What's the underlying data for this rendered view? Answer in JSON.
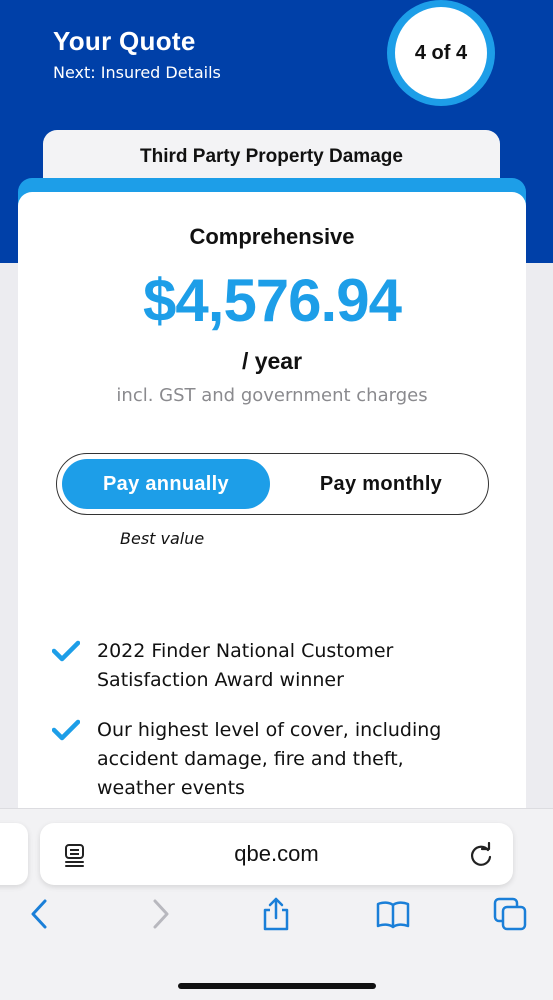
{
  "header": {
    "title": "Your Quote",
    "subtitle": "Next: Insured Details",
    "step": "4 of 4"
  },
  "tabs": {
    "other_plan": "Third Party Property Damage",
    "active_plan": "Comprehensive"
  },
  "quote": {
    "price": "$4,576.94",
    "period": "/ year",
    "note": "incl. GST and government charges"
  },
  "payment_toggle": {
    "annual": "Pay annually",
    "monthly": "Pay monthly",
    "selected": "annual",
    "annual_note": "Best value"
  },
  "features": [
    {
      "text": "2022 Finder National Customer Satisfaction Award winner"
    },
    {
      "text": "Our highest level of cover, including accident damage, fire and theft, weather events"
    }
  ],
  "browser": {
    "domain": "qbe.com"
  },
  "colors": {
    "brand_navy": "#0040a8",
    "accent_blue": "#1d9ee8"
  },
  "icons": [
    "reader-icon",
    "reload-icon",
    "back-icon",
    "forward-icon",
    "share-icon",
    "bookmarks-icon",
    "tabs-icon",
    "check-icon"
  ]
}
